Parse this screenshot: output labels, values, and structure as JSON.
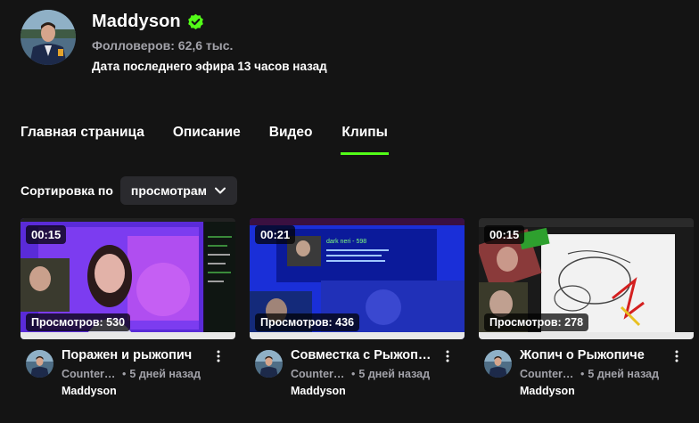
{
  "channel": {
    "name": "Maddyson",
    "followers": "Фолловеров: 62,6 тыс.",
    "last_stream": "Дата последнего эфира 13 часов назад",
    "accent_color": "#53fc18"
  },
  "tabs": [
    {
      "label": "Главная страница",
      "active": false
    },
    {
      "label": "Описание",
      "active": false
    },
    {
      "label": "Видео",
      "active": false
    },
    {
      "label": "Клипы",
      "active": true
    }
  ],
  "sort": {
    "label": "Сортировка по",
    "selected": "просмотрам"
  },
  "clips": [
    {
      "duration": "00:15",
      "views": "Просмотров: 530",
      "title": "Поражен и рыжопич",
      "category": "Counter-...",
      "age": "5 дней назад",
      "channel": "Maddyson"
    },
    {
      "duration": "00:21",
      "views": "Просмотров: 436",
      "title": "Совместка с Рыжопи...",
      "category": "Counter-...",
      "age": "5 дней назад",
      "channel": "Maddyson"
    },
    {
      "duration": "00:15",
      "views": "Просмотров: 278",
      "title": "Жопич о Рыжопиче",
      "category": "Counter-...",
      "age": "5 дней назад",
      "channel": "Maddyson"
    }
  ]
}
